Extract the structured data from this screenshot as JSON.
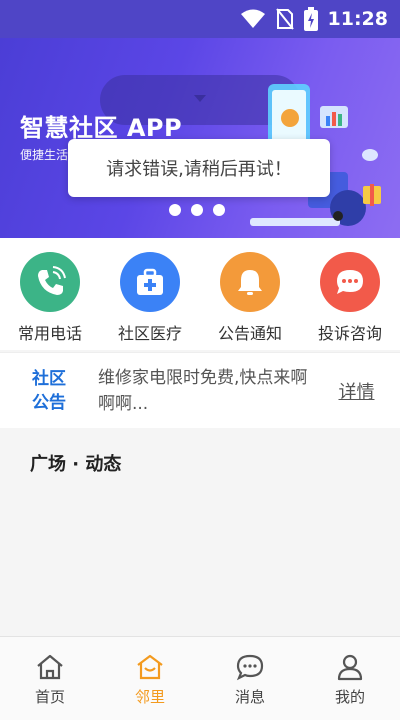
{
  "status_bar": {
    "time": "11:28"
  },
  "banner": {
    "title": "智慧社区 APP",
    "subtitle": "便捷生活",
    "toast": "请求错误,请稍后再试！",
    "dots_count": 3
  },
  "quick_actions": [
    {
      "label": "常用电话",
      "icon": "phone-icon",
      "color": "#3cb487"
    },
    {
      "label": "社区医疗",
      "icon": "medical-kit-icon",
      "color": "#3b82f6"
    },
    {
      "label": "公告通知",
      "icon": "bell-icon",
      "color": "#f39a3a"
    },
    {
      "label": "投诉咨询",
      "icon": "chat-bubble-icon",
      "color": "#f25a4a"
    }
  ],
  "notice": {
    "tag_line1": "社区",
    "tag_line2": "公告",
    "text": "维修家电限时免费,快点来啊啊啊...",
    "link": "详情"
  },
  "feed": {
    "title": "广场 · 动态"
  },
  "bottom_nav": [
    {
      "label": "首页",
      "icon": "home-icon",
      "active": false
    },
    {
      "label": "邻里",
      "icon": "neighbor-house-icon",
      "active": true
    },
    {
      "label": "消息",
      "icon": "message-icon",
      "active": false
    },
    {
      "label": "我的",
      "icon": "person-icon",
      "active": false
    }
  ],
  "colors": {
    "accent": "#f39a1e",
    "notice_blue": "#1e6fd9",
    "banner": "#5b46e6"
  }
}
